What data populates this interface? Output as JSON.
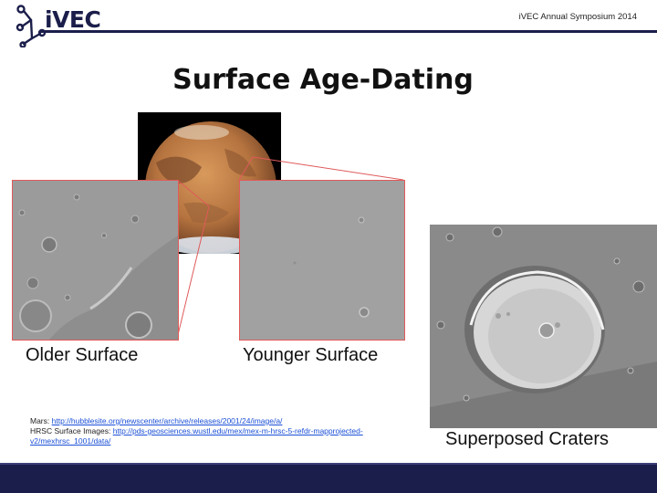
{
  "header": {
    "logo_text": "iVEC",
    "event_label": "iVEC Annual Symposium 2014",
    "colors": {
      "brand_navy": "#1b1e4a",
      "link_blue": "#1a4fd6",
      "connector_red": "#e05a5a"
    }
  },
  "slide": {
    "title": "Surface Age-Dating"
  },
  "images": {
    "mars": {
      "icon": "mars-planet-image"
    },
    "older": {
      "caption": "Older Surface"
    },
    "younger": {
      "caption": "Younger Surface"
    },
    "craters": {
      "caption": "Superposed Craters"
    }
  },
  "credits": {
    "mars_label": "Mars: ",
    "mars_link": "http://hubblesite.org/newscenter/archive/releases/2001/24/image/a/",
    "hrsc_label": "HRSC Surface Images: ",
    "hrsc_link": "http://pds-geosciences.wustl.edu/mex/mex-m-hrsc-5-refdr-mapprojected-v2/mexhrsc_1001/data/"
  }
}
